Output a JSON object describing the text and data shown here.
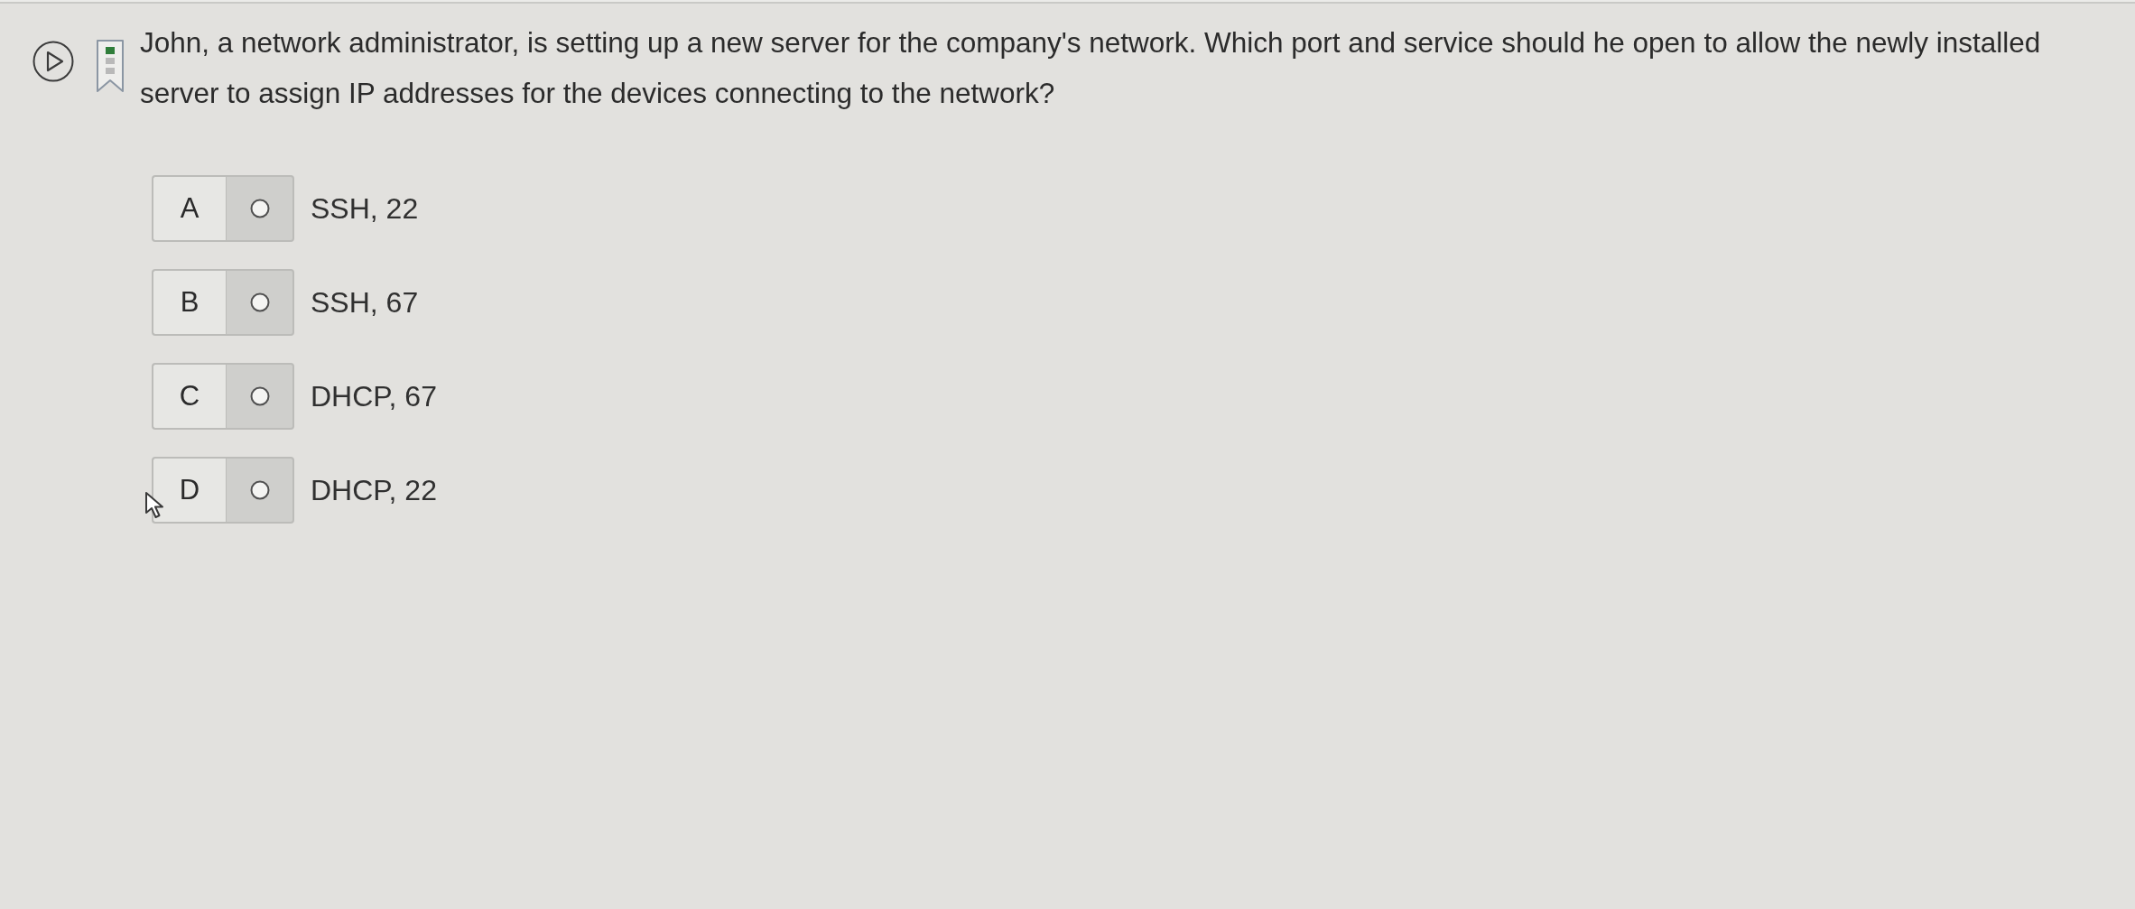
{
  "question": {
    "text": "John, a network administrator, is setting up a new server for the company's network. Which port and service should he open to allow the newly installed server to assign IP addresses for the devices connecting to the network?"
  },
  "options": [
    {
      "letter": "A",
      "text": "SSH, 22",
      "selected": false
    },
    {
      "letter": "B",
      "text": "SSH, 67",
      "selected": false
    },
    {
      "letter": "C",
      "text": "DHCP, 67",
      "selected": false
    },
    {
      "letter": "D",
      "text": "DHCP, 22",
      "selected": false
    }
  ]
}
